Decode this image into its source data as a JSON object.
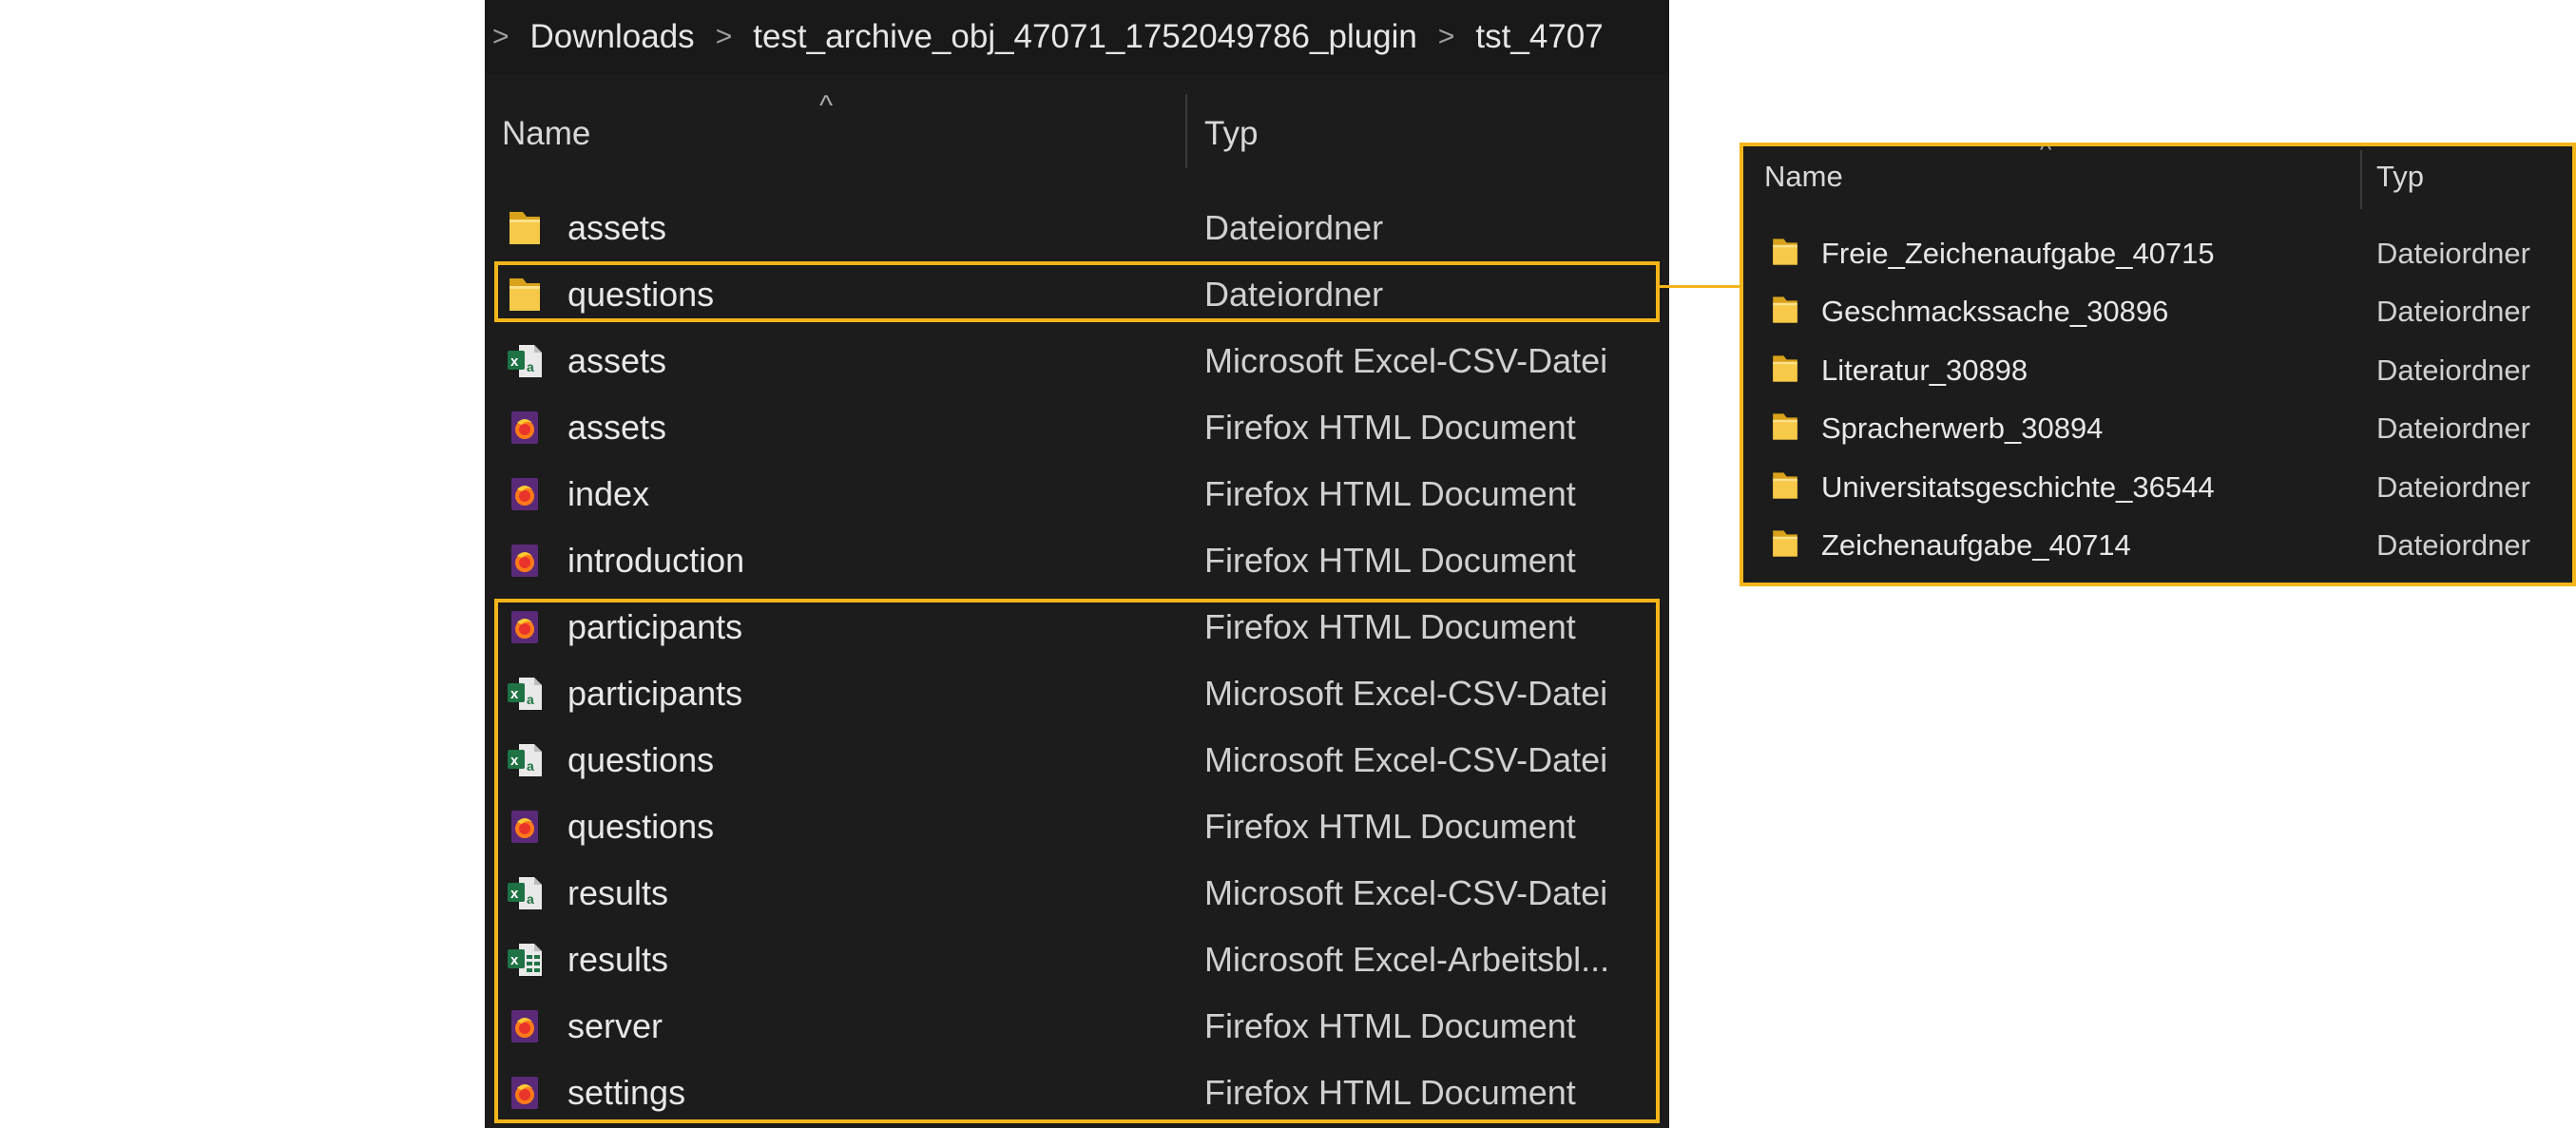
{
  "breadcrumb": {
    "sep": ">",
    "items": [
      "Downloads",
      "test_archive_obj_47071_1752049786_plugin",
      "tst_4707"
    ]
  },
  "columns": {
    "name": "Name",
    "type": "Typ",
    "sort_indicator": "^"
  },
  "files": [
    {
      "name": "assets",
      "type": "Dateiordner",
      "icon": "folder-icon"
    },
    {
      "name": "questions",
      "type": "Dateiordner",
      "icon": "folder-icon"
    },
    {
      "name": "assets",
      "type": "Microsoft Excel-CSV-Datei",
      "icon": "excel-csv-icon"
    },
    {
      "name": "assets",
      "type": "Firefox HTML Document",
      "icon": "firefox-html-icon"
    },
    {
      "name": "index",
      "type": "Firefox HTML Document",
      "icon": "firefox-html-icon"
    },
    {
      "name": "introduction",
      "type": "Firefox HTML Document",
      "icon": "firefox-html-icon"
    },
    {
      "name": "participants",
      "type": "Firefox HTML Document",
      "icon": "firefox-html-icon"
    },
    {
      "name": "participants",
      "type": "Microsoft Excel-CSV-Datei",
      "icon": "excel-csv-icon"
    },
    {
      "name": "questions",
      "type": "Microsoft Excel-CSV-Datei",
      "icon": "excel-csv-icon"
    },
    {
      "name": "questions",
      "type": "Firefox HTML Document",
      "icon": "firefox-html-icon"
    },
    {
      "name": "results",
      "type": "Microsoft Excel-CSV-Datei",
      "icon": "excel-csv-icon"
    },
    {
      "name": "results",
      "type": "Microsoft Excel-Arbeitsbl...",
      "icon": "excel-worksheet-icon"
    },
    {
      "name": "server",
      "type": "Firefox HTML Document",
      "icon": "firefox-html-icon"
    },
    {
      "name": "settings",
      "type": "Firefox HTML Document",
      "icon": "firefox-html-icon"
    }
  ],
  "subfolder_panel": {
    "columns": {
      "name": "Name",
      "type": "Typ",
      "sort_indicator": "^"
    },
    "items": [
      {
        "name": "Freie_Zeichenaufgabe_40715",
        "type": "Dateiordner",
        "icon": "folder-icon"
      },
      {
        "name": "Geschmackssache_30896",
        "type": "Dateiordner",
        "icon": "folder-icon"
      },
      {
        "name": "Literatur_30898",
        "type": "Dateiordner",
        "icon": "folder-icon"
      },
      {
        "name": "Spracherwerb_30894",
        "type": "Dateiordner",
        "icon": "folder-icon"
      },
      {
        "name": "Universitatsgeschichte_36544",
        "type": "Dateiordner",
        "icon": "folder-icon"
      },
      {
        "name": "Zeichenaufgabe_40714",
        "type": "Dateiordner",
        "icon": "folder-icon"
      }
    ]
  },
  "colors": {
    "background": "#1c1c1c",
    "highlight": "#f3b519",
    "folder": "#f5c542",
    "excel": "#1f7244",
    "firefox": "#e8562a"
  }
}
